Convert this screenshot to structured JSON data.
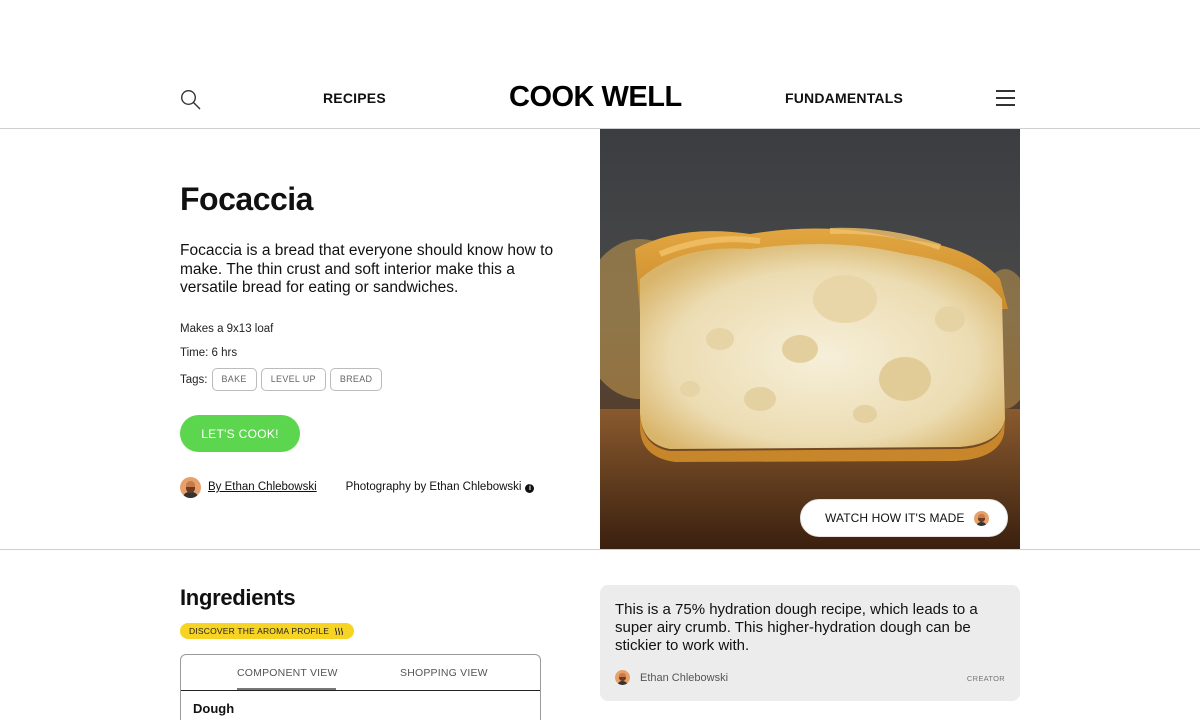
{
  "header": {
    "logo": "COOK WELL",
    "nav_recipes": "RECIPES",
    "nav_fundamentals": "FUNDAMENTALS",
    "icons": {
      "search": "search-icon",
      "menu": "hamburger-menu-icon"
    }
  },
  "recipe": {
    "title": "Focaccia",
    "description": "Focaccia is a bread that everyone should know how to make. The thin crust and soft interior make this a versatile bread for eating or sandwiches.",
    "yield": "Makes a 9x13 loaf",
    "time": "Time: 6 hrs",
    "tags_label": "Tags:",
    "tags": [
      "BAKE",
      "LEVEL UP",
      "BREAD"
    ],
    "cta_label": "LET'S COOK!",
    "author": "By Ethan Chlebowski",
    "photo_credit": "Photography by Ethan Chlebowski",
    "watch_label": "WATCH HOW IT'S MADE"
  },
  "ingredients": {
    "title": "Ingredients",
    "aroma_label": "DISCOVER THE AROMA PROFILE",
    "tabs": [
      "COMPONENT VIEW",
      "SHOPPING VIEW"
    ],
    "active_tab": "COMPONENT VIEW",
    "section": "Dough"
  },
  "note": {
    "text": "This is a 75% hydration dough recipe, which leads to a super airy crumb. This higher-hydration dough can be stickier to work with.",
    "author": "Ethan Chlebowski",
    "badge": "CREATOR"
  },
  "colors": {
    "accent_green": "#5dd64f",
    "badge_yellow": "#f7d423",
    "note_bg": "#ececec"
  }
}
